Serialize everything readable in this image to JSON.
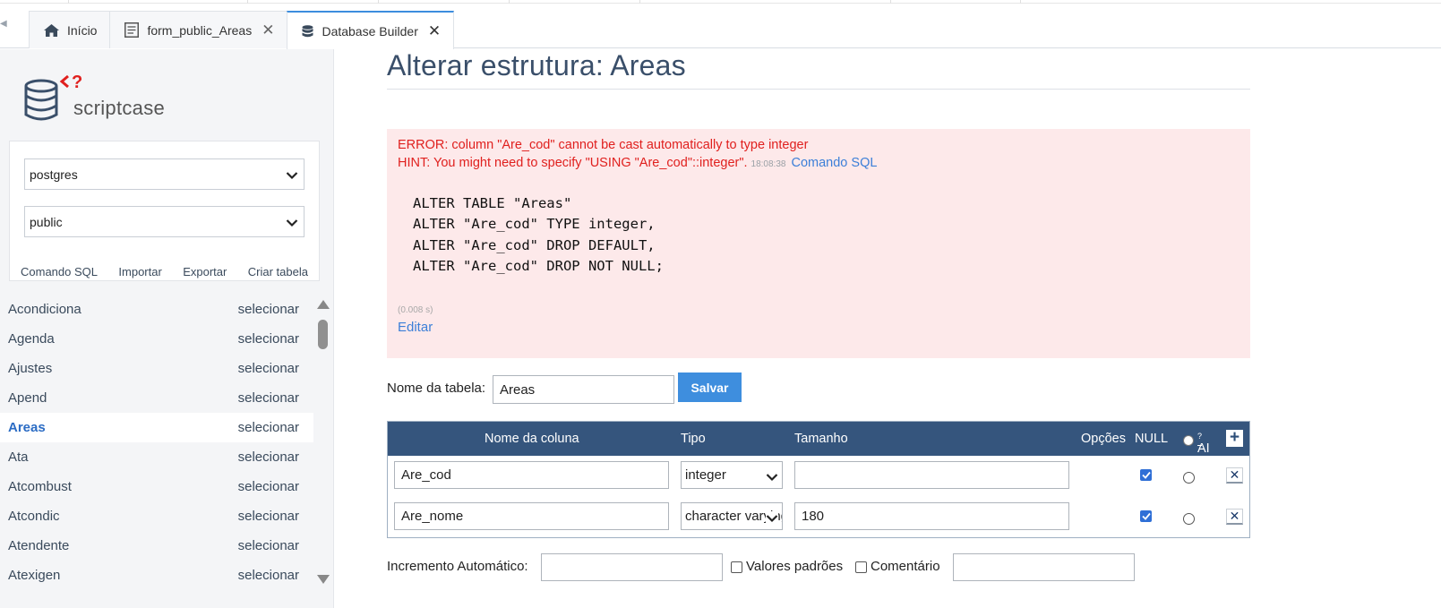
{
  "tabs": [
    {
      "label": "Início",
      "icon": "home-icon",
      "closable": false,
      "active": false
    },
    {
      "label": "form_public_Areas",
      "icon": "form-icon",
      "closable": true,
      "active": false
    },
    {
      "label": "Database Builder",
      "icon": "database-icon",
      "closable": true,
      "active": true
    }
  ],
  "sidebar": {
    "logo_text": "scriptcase",
    "database_select": "postgres",
    "schema_select": "public",
    "links": [
      "Comando SQL",
      "Importar",
      "Exportar",
      "Criar tabela"
    ],
    "select_label": "selecionar",
    "tables": [
      "Acondiciona",
      "Agenda",
      "Ajustes",
      "Apend",
      "Areas",
      "Ata",
      "Atcombust",
      "Atcondic",
      "Atendente",
      "Atexigen"
    ],
    "active_table": "Areas"
  },
  "main": {
    "title": "Alterar estrutura: Areas",
    "error": {
      "line1": "ERROR: column \"Are_cod\" cannot be cast automatically to type integer",
      "line2": "HINT: You might need to specify \"USING \"Are_cod\"::integer\".",
      "time": "18:08:38",
      "sql_link": "Comando SQL",
      "sql": "ALTER TABLE \"Areas\"\nALTER \"Are_cod\" TYPE integer,\nALTER \"Are_cod\" DROP DEFAULT,\nALTER \"Are_cod\" DROP NOT NULL;",
      "elapsed": "(0.008 s)",
      "edit_link": "Editar"
    },
    "table_name_label": "Nome da tabela:",
    "table_name_value": "Areas",
    "save_label": "Salvar",
    "columns_header": {
      "name": "Nome da coluna",
      "type": "Tipo",
      "size": "Tamanho",
      "options": "Opções",
      "null": "NULL",
      "ai": "AI",
      "ai_sup": "?"
    },
    "columns": [
      {
        "name": "Are_cod",
        "type": "integer",
        "size": "",
        "null": true
      },
      {
        "name": "Are_nome",
        "type": "character varying",
        "size": "180",
        "null": true
      }
    ],
    "auto_increment_label": "Incremento Automático:",
    "defaults_label": "Valores padrões",
    "comment_label": "Comentário"
  },
  "colors": {
    "header_bg": "#35557d",
    "error_bg": "#fde9ea",
    "error_text": "#e0201e",
    "link": "#3c7fd8",
    "save_button": "#3e8ede"
  }
}
